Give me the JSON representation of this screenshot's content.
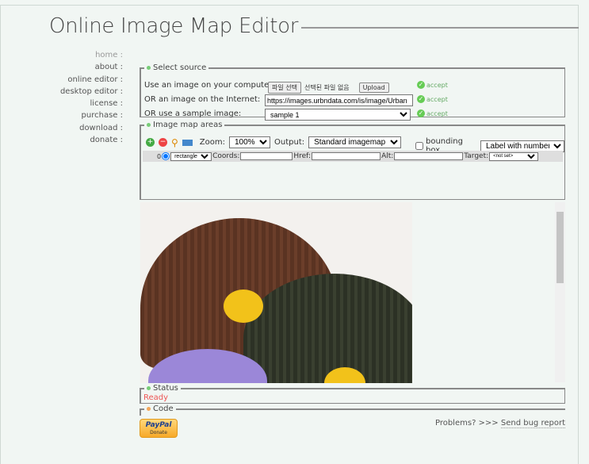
{
  "header": {
    "title": "Online Image Map Editor"
  },
  "nav": [
    {
      "label": "home :",
      "dim": true
    },
    {
      "label": "about :"
    },
    {
      "label": "online editor :"
    },
    {
      "label": "desktop editor :"
    },
    {
      "label": "license :"
    },
    {
      "label": "purchase :"
    },
    {
      "label": "download :"
    },
    {
      "label": "donate :"
    }
  ],
  "source": {
    "legend": "Select source",
    "local_label": "Use an image on your computer:",
    "file_button": "파일 선택",
    "file_status": "선택된 파일 없음",
    "upload": "Upload",
    "url_label": "OR an image on the Internet:",
    "url_value": "https://images.urbndata.com/is/image/Urban",
    "sample_label": "OR use a sample image:",
    "sample_value": "sample 1",
    "accept": "accept"
  },
  "areas": {
    "legend": "Image map areas",
    "zoom_label": "Zoom:",
    "zoom_value": "100%",
    "output_label": "Output:",
    "output_value": "Standard imagemap",
    "bbox_label": "bounding box",
    "label_mode": "Label with numbers",
    "row": {
      "index": "0",
      "shape": "rectangle",
      "coords_label": "Coords:",
      "href_label": "Href:",
      "alt_label": "Alt:",
      "target_label": "Target:",
      "target_value": "<not set>"
    }
  },
  "status": {
    "legend": "Status",
    "text": "Ready",
    "color": "#e55"
  },
  "code": {
    "legend": "Code"
  },
  "paypal": {
    "brand": "PayPal",
    "label": "Donate"
  },
  "footer": {
    "problems": "Problems? >>>",
    "bug_link": "Send bug report"
  }
}
